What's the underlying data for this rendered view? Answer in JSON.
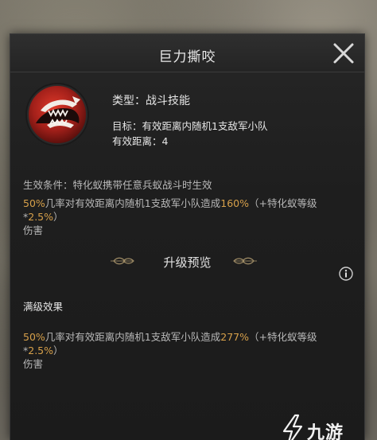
{
  "window": {
    "title": "巨力撕咬"
  },
  "skill": {
    "icon": "serpent-bite-icon",
    "type": "类型：战斗技能",
    "target": "目标：有效距离内随机1支敌军小队",
    "range": "有效距离：4",
    "condition": "生效条件：特化蚁携带任意兵蚁战斗时生效",
    "effect": {
      "pct1": "50%",
      "mid": "几率对有效距离内随机1支敌军小队造成",
      "pct2": "160%",
      "bonus_pre": "（+特化蚁等级*",
      "bonus_val": "2.5%",
      "bonus_post": "）",
      "tail": "伤害"
    }
  },
  "upgrade": {
    "section_title": "升级预览",
    "info_icon": "info-icon",
    "max_label": "满级效果",
    "effect": {
      "pct1": "50%",
      "mid": "几率对有效距离内随机1支敌军小队造成",
      "pct2": "277%",
      "bonus_pre": "（+特化蚁等级*",
      "bonus_val": "2.5%",
      "bonus_post": "）",
      "tail": "伤害"
    }
  },
  "watermark": {
    "text": "九游"
  },
  "colors": {
    "highlight": "#d7a04a",
    "panel": "#1e1e1e",
    "icon_red": "#b3261e"
  }
}
